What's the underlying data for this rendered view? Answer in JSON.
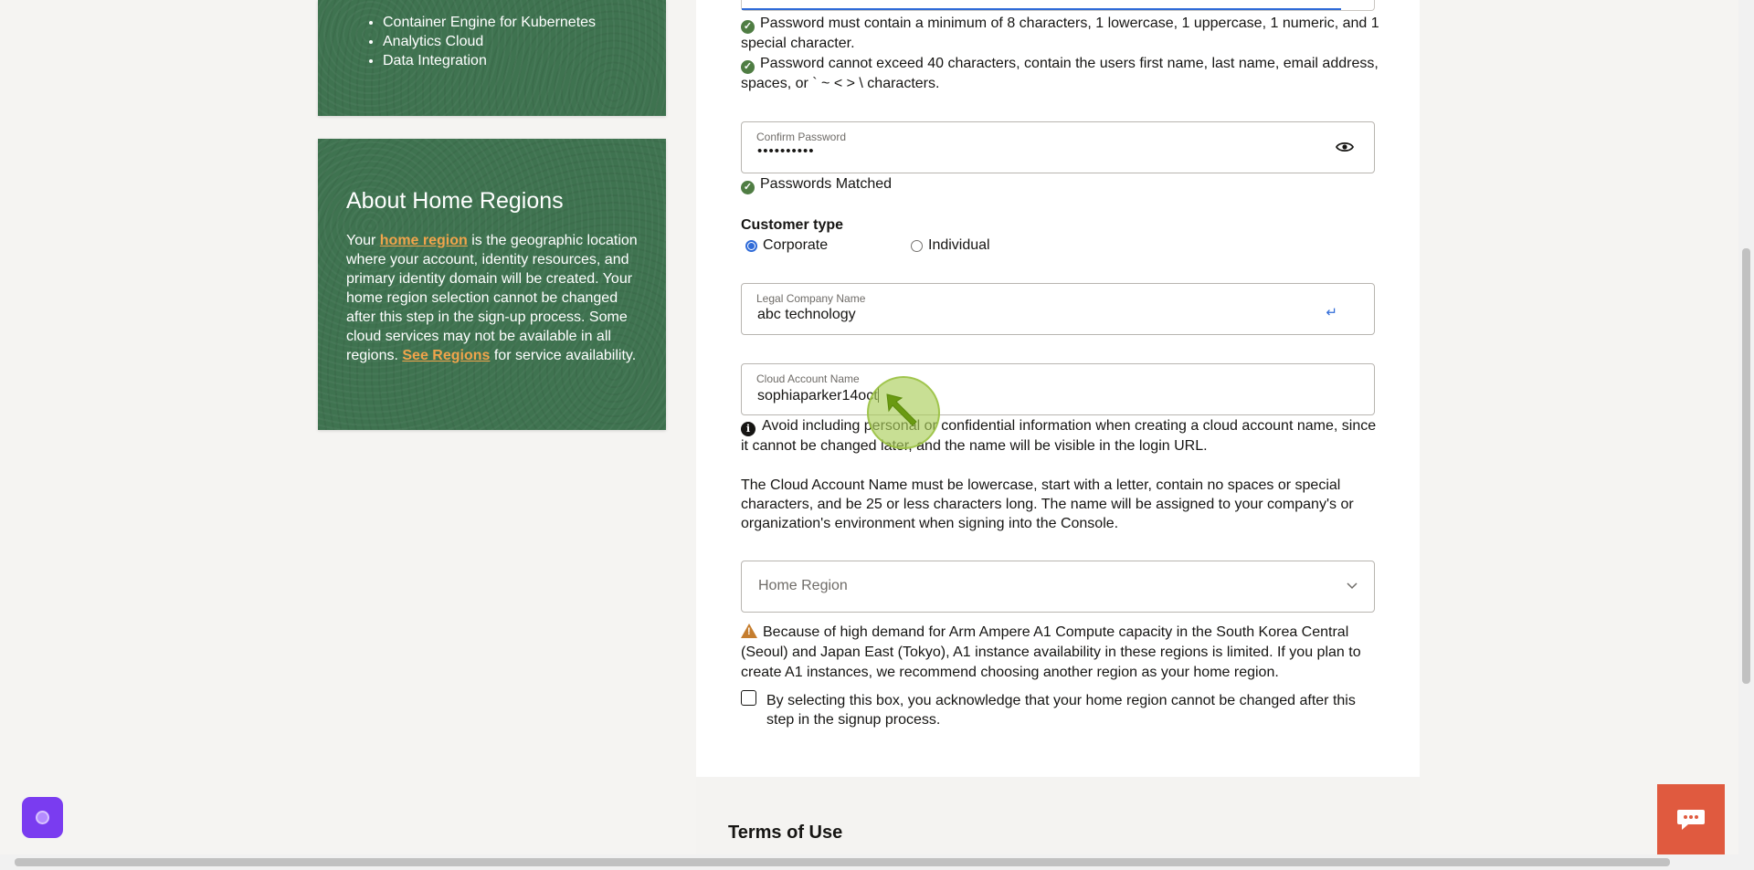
{
  "sidebar": {
    "services": [
      "Container Engine for Kubernetes",
      "Analytics Cloud",
      "Data Integration"
    ],
    "regions_card": {
      "title": "About Home Regions",
      "text_1": "Your ",
      "link_home_region": "home region",
      "text_2": " is the geographic location where your account, identity resources, and primary identity domain will be created. Your home region selection cannot be changed after this step in the sign-up process. Some cloud services may not be available in all regions. ",
      "link_see_regions": "See Regions",
      "text_3": " for service availability."
    }
  },
  "form": {
    "password_rule_1": "Password must contain a minimum of 8 characters, 1 lowercase, 1 uppercase, 1 numeric, and 1 special character.",
    "password_rule_2": "Password cannot exceed 40 characters, contain the users first name, last name, email address, spaces, or ` ~ < > \\ characters.",
    "confirm_password": {
      "label": "Confirm Password",
      "value": "••••••••••"
    },
    "passwords_matched": "Passwords Matched",
    "customer_type": {
      "label": "Customer type",
      "options": [
        "Corporate",
        "Individual"
      ],
      "selected": "Corporate"
    },
    "legal_company_name": {
      "label": "Legal Company Name",
      "value": "abc technology",
      "enter_glyph": "↵"
    },
    "cloud_account_name": {
      "label": "Cloud Account Name",
      "value": "sophiaparker14oct"
    },
    "cloud_account_info": "Avoid including personal or confidential information when creating a cloud account name, since it cannot be changed later, and the name will be visible in the login URL.",
    "cloud_account_rules": "The Cloud Account Name must be lowercase, start with a letter, contain no spaces or special characters, and be 25 or less characters long. The name will be assigned to your company's or organization's environment when signing into the Console.",
    "home_region": {
      "placeholder": "Home Region"
    },
    "arm_warning": "Because of high demand for Arm Ampere A1 Compute capacity in the South Korea Central (Seoul) and Japan East (Tokyo), A1 instance availability in these regions is limited. If you plan to create A1 instances, we recommend choosing another region as your home region.",
    "acknowledge_checkbox": {
      "label": "By selecting this box, you acknowledge that your home region cannot be changed after this step in the signup process.",
      "checked": false
    }
  },
  "terms": {
    "title": "Terms of Use"
  },
  "colors": {
    "card_green": "#3f7350",
    "link_orange": "#f0a44b",
    "accent_blue": "#2f6bd8",
    "chat_red": "#e05a3f",
    "assistant_purple": "#7a3cf0"
  },
  "icons": [
    "check-circle-icon",
    "eye-icon",
    "enter-key-icon",
    "info-icon",
    "chevron-down-icon",
    "warning-icon",
    "chat-icon",
    "assistant-icon"
  ]
}
